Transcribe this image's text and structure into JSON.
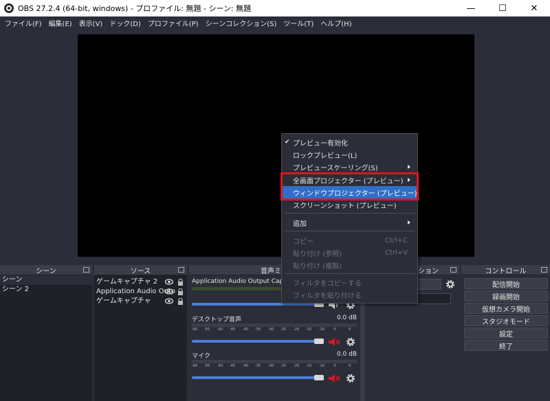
{
  "window": {
    "title": "OBS 27.2.4 (64-bit, windows) - プロファイル: 無題 - シーン: 無題",
    "minimize": "—",
    "maximize": "☐",
    "close": "✕"
  },
  "menubar": [
    "ファイル(F)",
    "編集(E)",
    "表示(V)",
    "ドック(D)",
    "プロファイル(P)",
    "シーンコレクション(S)",
    "ツール(T)",
    "ヘルプ(H)"
  ],
  "docks": {
    "scenes": {
      "title": "シーン",
      "items": [
        "シーン",
        "シーン 2"
      ]
    },
    "sources": {
      "title": "ソース",
      "items": [
        "ゲームキャプチャ 2",
        "Application Audio Outp",
        "ゲームキャプチャ"
      ]
    },
    "mixer": {
      "title": "音声ミキサ",
      "channels": [
        {
          "name": "Application Audio Output Capture",
          "db": "",
          "volume": 0.95,
          "muted": false
        },
        {
          "name": "デスクトップ音声",
          "db": "0.0 dB",
          "volume": 0.95,
          "muted": true
        },
        {
          "name": "マイク",
          "db": "0.0 dB",
          "volume": 0.95,
          "muted": true
        }
      ],
      "ticks": [
        "-60",
        "-55",
        "-50",
        "-45",
        "-40",
        "-35",
        "-30",
        "-25",
        "-20",
        "-15",
        "-10",
        "-5",
        "0"
      ]
    },
    "transitions": {
      "title": "ション"
    },
    "controls": {
      "title": "コントロール",
      "buttons": [
        "配信開始",
        "録画開始",
        "仮想カメラ開始",
        "スタジオモード",
        "設定",
        "終了"
      ]
    }
  },
  "context_menu": {
    "items": [
      {
        "label": "プレビュー有効化",
        "check": "✔",
        "shortcut": "",
        "submenu": false,
        "disabled": false
      },
      {
        "label": "ロックプレビュー(L)",
        "check": "",
        "shortcut": "",
        "submenu": false,
        "disabled": false
      },
      {
        "label": "プレビュースケーリング(S)",
        "check": "",
        "shortcut": "",
        "submenu": true,
        "disabled": false
      },
      {
        "label": "全画面プロジェクター (プレビュー)",
        "check": "",
        "shortcut": "",
        "submenu": true,
        "disabled": false
      },
      {
        "label": "ウィンドウプロジェクター (プレビュー)",
        "check": "",
        "shortcut": "",
        "submenu": false,
        "disabled": false,
        "highlighted": true
      },
      {
        "label": "スクリーンショット (プレビュー)",
        "check": "",
        "shortcut": "",
        "submenu": false,
        "disabled": false
      },
      {
        "label": "追加",
        "check": "",
        "shortcut": "",
        "submenu": true,
        "disabled": false
      },
      {
        "label": "コピー",
        "check": "",
        "shortcut": "Ctrl+C",
        "submenu": false,
        "disabled": true
      },
      {
        "label": "貼り付け (参照)",
        "check": "",
        "shortcut": "Ctrl+V",
        "submenu": false,
        "disabled": true
      },
      {
        "label": "貼り付け (複製)",
        "check": "",
        "shortcut": "",
        "submenu": false,
        "disabled": true
      },
      {
        "label": "フィルタをコピーする",
        "check": "",
        "shortcut": "",
        "submenu": false,
        "disabled": true
      },
      {
        "label": "フィルタを貼り付ける",
        "check": "",
        "shortcut": "",
        "submenu": false,
        "disabled": true
      }
    ]
  },
  "colors": {
    "highlight": "#2f6fc8",
    "annotation_box": "#e0141e",
    "mute_red": "#e0141e"
  }
}
